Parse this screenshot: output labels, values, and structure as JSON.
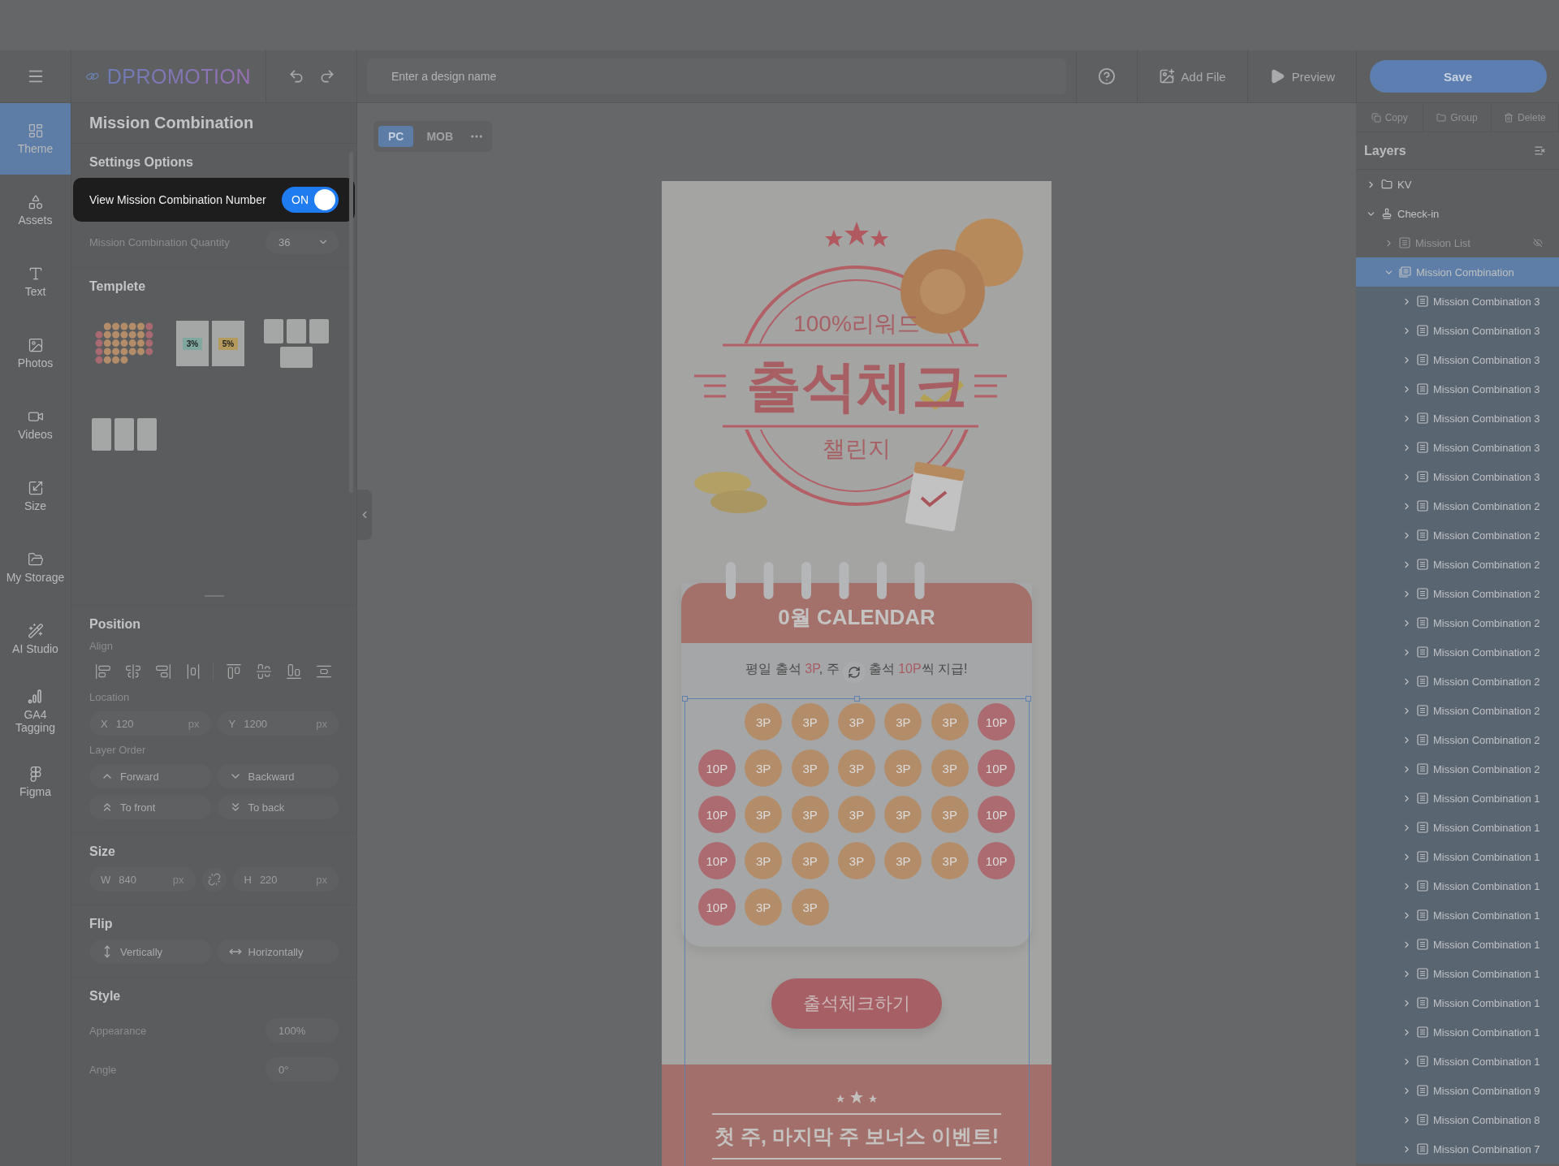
{
  "topbar": {
    "logo": "DPROMOTION",
    "design_name": {
      "placeholder": "Enter a design name"
    },
    "actions": [
      {
        "kind": "help"
      },
      {
        "kind": "add_file",
        "label": "Add File"
      },
      {
        "kind": "preview",
        "label": "Preview"
      }
    ],
    "save": "Save"
  },
  "rail": [
    {
      "kind": "theme",
      "label": "Theme",
      "selected": true
    },
    {
      "kind": "assets",
      "label": "Assets",
      "selected": false
    },
    {
      "kind": "text",
      "label": "Text",
      "selected": false
    },
    {
      "kind": "photos",
      "label": "Photos",
      "selected": false
    },
    {
      "kind": "videos",
      "label": "Videos",
      "selected": false
    },
    {
      "kind": "size",
      "label": "Size",
      "selected": false
    },
    {
      "kind": "storage",
      "label": "My Storage",
      "selected": false
    },
    {
      "kind": "ai",
      "label": "AI Studio",
      "selected": false
    },
    {
      "kind": "ga4",
      "label": "GA4 Tagging",
      "selected": false
    },
    {
      "kind": "figma",
      "label": "Figma",
      "selected": false
    }
  ],
  "panel": {
    "title": "Mission Combination",
    "settings": {
      "heading": "Settings Options",
      "toggle": {
        "label": "View Mission Combination Number",
        "on": true,
        "text": "ON"
      },
      "quantity": {
        "label": "Mission Combination Quantity",
        "value": "36"
      }
    },
    "template": {
      "heading": "Templete",
      "items": [
        {
          "kind": "coins"
        },
        {
          "kind": "coupons",
          "labels": [
            "3%",
            "5%"
          ]
        },
        {
          "kind": "products"
        },
        {
          "kind": "cards"
        }
      ]
    },
    "position": {
      "heading": "Position",
      "align_label": "Align",
      "location_label": "Location",
      "location": [
        {
          "axis": "X",
          "value": "120",
          "unit": "px"
        },
        {
          "axis": "Y",
          "value": "1200",
          "unit": "px"
        }
      ],
      "order_label": "Layer Order",
      "order": [
        {
          "kind": "forward",
          "label": "Forward"
        },
        {
          "kind": "backward",
          "label": "Backward"
        },
        {
          "kind": "front",
          "label": "To front"
        },
        {
          "kind": "back",
          "label": "To back"
        }
      ]
    },
    "size": {
      "heading": "Size",
      "fields": [
        {
          "axis": "W",
          "value": "840",
          "unit": "px"
        },
        {
          "axis": "H",
          "value": "220",
          "unit": "px"
        }
      ],
      "linked": false
    },
    "flip": {
      "heading": "Flip",
      "buttons": [
        {
          "kind": "vertical",
          "label": "Vertically"
        },
        {
          "kind": "horizontal",
          "label": "Horizontally"
        }
      ]
    },
    "style": {
      "heading": "Style",
      "rows": [
        {
          "label": "Appearance",
          "value": "100%"
        },
        {
          "label": "Angle",
          "value": "0°"
        }
      ]
    }
  },
  "canvas": {
    "views": [
      {
        "label": "PC",
        "selected": true
      },
      {
        "label": "MOB",
        "selected": false
      }
    ],
    "design": {
      "kv": {
        "reward": "100%리워드",
        "title": "출석체크",
        "subtitle": "챌린지"
      },
      "calendar": {
        "title": "0월 CALENDAR",
        "note": [
          "평일 출석 **3P**, 주",
          "출석 **10P**씩 지급!"
        ],
        "button": "출석체크하기",
        "days": [
          {
            "kind": "blank"
          },
          {
            "kind": "weekday",
            "reward": "3P"
          },
          {
            "kind": "weekday",
            "reward": "3P"
          },
          {
            "kind": "weekday",
            "reward": "3P"
          },
          {
            "kind": "weekday",
            "reward": "3P"
          },
          {
            "kind": "weekday",
            "reward": "3P"
          },
          {
            "kind": "weekend",
            "reward": "10P"
          },
          {
            "kind": "weekend",
            "reward": "10P"
          },
          {
            "kind": "weekday",
            "reward": "3P"
          },
          {
            "kind": "weekday",
            "reward": "3P"
          },
          {
            "kind": "weekday",
            "reward": "3P"
          },
          {
            "kind": "weekday",
            "reward": "3P"
          },
          {
            "kind": "weekday",
            "reward": "3P"
          },
          {
            "kind": "weekend",
            "reward": "10P"
          },
          {
            "kind": "weekend",
            "reward": "10P"
          },
          {
            "kind": "weekday",
            "reward": "3P"
          },
          {
            "kind": "weekday",
            "reward": "3P"
          },
          {
            "kind": "weekday",
            "reward": "3P"
          },
          {
            "kind": "weekday",
            "reward": "3P"
          },
          {
            "kind": "weekday",
            "reward": "3P"
          },
          {
            "kind": "weekend",
            "reward": "10P"
          },
          {
            "kind": "weekend",
            "reward": "10P"
          },
          {
            "kind": "weekday",
            "reward": "3P"
          },
          {
            "kind": "weekday",
            "reward": "3P"
          },
          {
            "kind": "weekday",
            "reward": "3P"
          },
          {
            "kind": "weekday",
            "reward": "3P"
          },
          {
            "kind": "weekday",
            "reward": "3P"
          },
          {
            "kind": "weekend",
            "reward": "10P"
          },
          {
            "kind": "weekend",
            "reward": "10P"
          },
          {
            "kind": "weekday",
            "reward": "3P"
          },
          {
            "kind": "weekday",
            "reward": "3P"
          }
        ]
      },
      "banner": {
        "title": "첫 주, 마지막 주 보너스 이벤트!"
      }
    }
  },
  "layers": {
    "toolbar": [
      {
        "kind": "copy",
        "label": "Copy"
      },
      {
        "kind": "group",
        "label": "Group"
      },
      {
        "kind": "delete",
        "label": "Delete"
      }
    ],
    "title": "Layers",
    "tree": [
      {
        "label": "KV",
        "kind": "folder",
        "expanded": false,
        "selected": false,
        "visible": true
      },
      {
        "label": "Check-in",
        "kind": "stamp",
        "expanded": true,
        "selected": false,
        "visible": true,
        "children": [
          {
            "label": "Mission List",
            "kind": "list",
            "expanded": false,
            "selected": false,
            "visible": false
          },
          {
            "label": "Mission Combination",
            "kind": "stack",
            "expanded": true,
            "selected": true,
            "visible": true,
            "children": [
              {
                "label": "Mission Combination 3",
                "kind": "list",
                "expanded": false,
                "selected": false,
                "visible": true
              },
              {
                "label": "Mission Combination 3",
                "kind": "list",
                "expanded": false,
                "selected": false,
                "visible": true
              },
              {
                "label": "Mission Combination 3",
                "kind": "list",
                "expanded": false,
                "selected": false,
                "visible": true
              },
              {
                "label": "Mission Combination 3",
                "kind": "list",
                "expanded": false,
                "selected": false,
                "visible": true
              },
              {
                "label": "Mission Combination 3",
                "kind": "list",
                "expanded": false,
                "selected": false,
                "visible": true
              },
              {
                "label": "Mission Combination 3",
                "kind": "list",
                "expanded": false,
                "selected": false,
                "visible": true
              },
              {
                "label": "Mission Combination 3",
                "kind": "list",
                "expanded": false,
                "selected": false,
                "visible": true
              },
              {
                "label": "Mission Combination 2",
                "kind": "list",
                "expanded": false,
                "selected": false,
                "visible": true
              },
              {
                "label": "Mission Combination 2",
                "kind": "list",
                "expanded": false,
                "selected": false,
                "visible": true
              },
              {
                "label": "Mission Combination 2",
                "kind": "list",
                "expanded": false,
                "selected": false,
                "visible": true
              },
              {
                "label": "Mission Combination 2",
                "kind": "list",
                "expanded": false,
                "selected": false,
                "visible": true
              },
              {
                "label": "Mission Combination 2",
                "kind": "list",
                "expanded": false,
                "selected": false,
                "visible": true
              },
              {
                "label": "Mission Combination 2",
                "kind": "list",
                "expanded": false,
                "selected": false,
                "visible": true
              },
              {
                "label": "Mission Combination 2",
                "kind": "list",
                "expanded": false,
                "selected": false,
                "visible": true
              },
              {
                "label": "Mission Combination 2",
                "kind": "list",
                "expanded": false,
                "selected": false,
                "visible": true
              },
              {
                "label": "Mission Combination 2",
                "kind": "list",
                "expanded": false,
                "selected": false,
                "visible": true
              },
              {
                "label": "Mission Combination 2",
                "kind": "list",
                "expanded": false,
                "selected": false,
                "visible": true
              },
              {
                "label": "Mission Combination 1",
                "kind": "list",
                "expanded": false,
                "selected": false,
                "visible": true
              },
              {
                "label": "Mission Combination 1",
                "kind": "list",
                "expanded": false,
                "selected": false,
                "visible": true
              },
              {
                "label": "Mission Combination 1",
                "kind": "list",
                "expanded": false,
                "selected": false,
                "visible": true
              },
              {
                "label": "Mission Combination 1",
                "kind": "list",
                "expanded": false,
                "selected": false,
                "visible": true
              },
              {
                "label": "Mission Combination 1",
                "kind": "list",
                "expanded": false,
                "selected": false,
                "visible": true
              },
              {
                "label": "Mission Combination 1",
                "kind": "list",
                "expanded": false,
                "selected": false,
                "visible": true
              },
              {
                "label": "Mission Combination 1",
                "kind": "list",
                "expanded": false,
                "selected": false,
                "visible": true
              },
              {
                "label": "Mission Combination 1",
                "kind": "list",
                "expanded": false,
                "selected": false,
                "visible": true
              },
              {
                "label": "Mission Combination 1",
                "kind": "list",
                "expanded": false,
                "selected": false,
                "visible": true
              },
              {
                "label": "Mission Combination 1",
                "kind": "list",
                "expanded": false,
                "selected": false,
                "visible": true
              },
              {
                "label": "Mission Combination 9",
                "kind": "list",
                "expanded": false,
                "selected": false,
                "visible": true
              },
              {
                "label": "Mission Combination 8",
                "kind": "list",
                "expanded": false,
                "selected": false,
                "visible": true
              },
              {
                "label": "Mission Combination 7",
                "kind": "list",
                "expanded": false,
                "selected": false,
                "visible": true
              }
            ]
          }
        ]
      }
    ]
  }
}
